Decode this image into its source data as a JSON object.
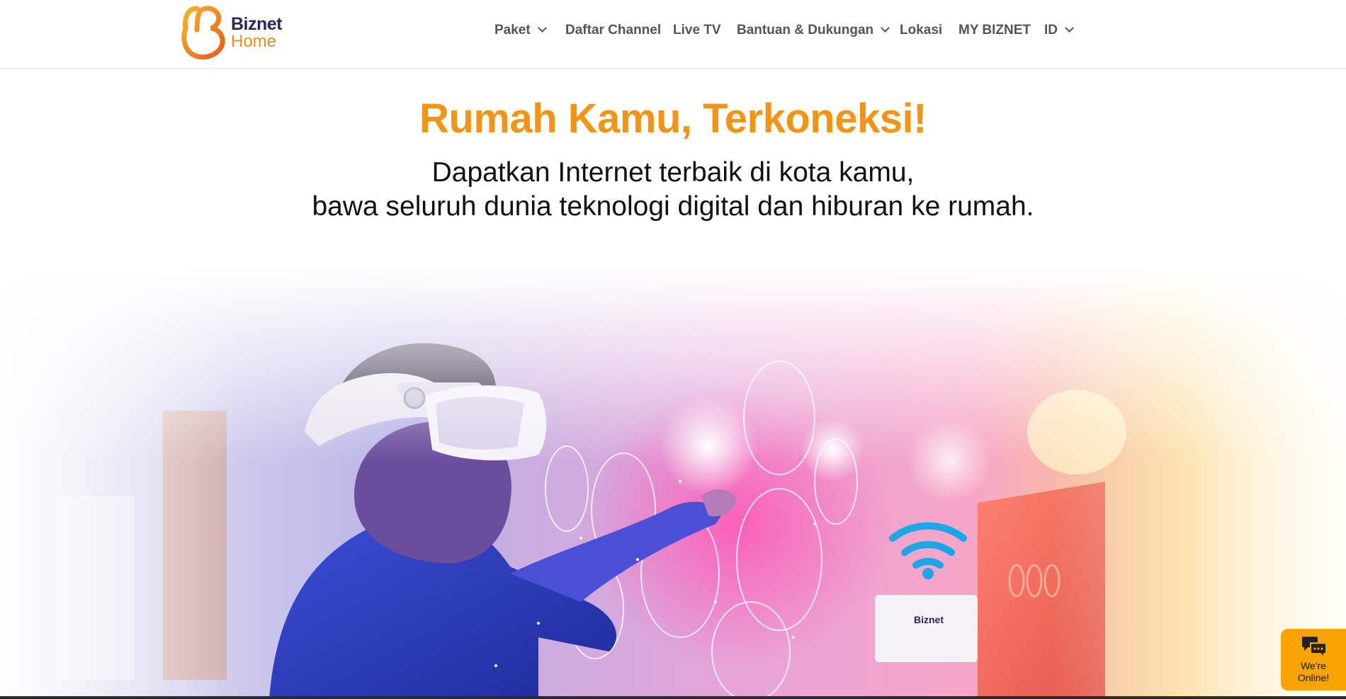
{
  "brand": {
    "name": "Biznet",
    "sub": "Home",
    "colors": {
      "orange": "#f39417",
      "navy": "#2b2560"
    },
    "logo_icon": "biznet-b-logo-icon"
  },
  "nav": {
    "items": [
      {
        "label": "Paket",
        "has_dropdown": true,
        "icon": "chevron-down-icon"
      },
      {
        "label": "Daftar Channel",
        "has_dropdown": false
      },
      {
        "label": "Live TV",
        "has_dropdown": false
      },
      {
        "label": "Bantuan & Dukungan",
        "has_dropdown": true,
        "icon": "chevron-down-icon"
      },
      {
        "label": "Lokasi",
        "has_dropdown": false
      },
      {
        "label": "MY BIZNET",
        "has_dropdown": false
      },
      {
        "label": "ID",
        "has_dropdown": true,
        "icon": "chevron-down-icon"
      }
    ]
  },
  "hero": {
    "headline": "Rumah Kamu, Terkoneksi!",
    "subline_1": "Dapatkan Internet terbaik di kota kamu,",
    "subline_2": "bawa seluruh dunia teknologi digital dan hiburan ke rumah.",
    "image_icon": "vr-user-hero-image",
    "router_brand": "Biznet"
  },
  "chat_widget": {
    "label_1": "We're",
    "label_2": "Online!",
    "icon": "chat-bubbles-icon",
    "color": "#f7a400"
  }
}
